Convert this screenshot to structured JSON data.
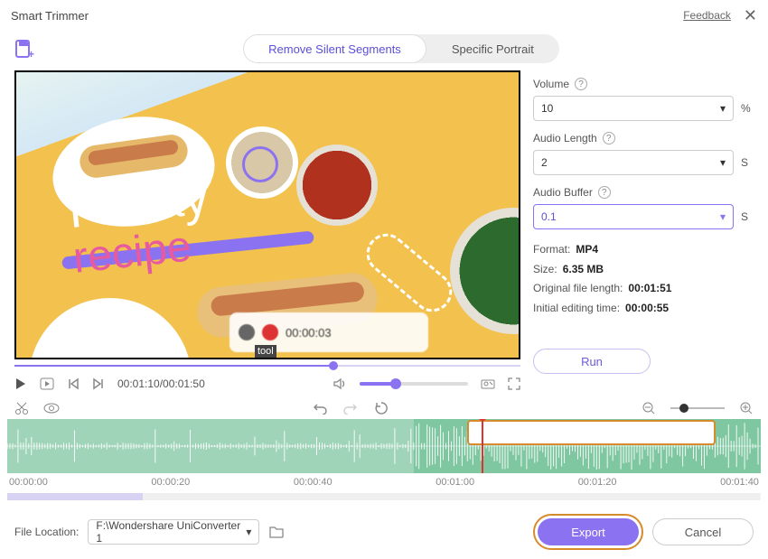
{
  "window": {
    "title": "Smart Trimmer",
    "feedback": "Feedback"
  },
  "tabs": {
    "remove": "Remove Silent Segments",
    "portrait": "Specific Portrait"
  },
  "preview": {
    "script_top": "Friday",
    "script_bottom": "recipe",
    "blur_time": "00:00:03",
    "tool_tip": "tool",
    "time_display": "00:01:10/00:01:50",
    "scrub_percent": 63
  },
  "panel": {
    "volume_label": "Volume",
    "volume_value": "10",
    "volume_unit": "%",
    "length_label": "Audio Length",
    "length_value": "2",
    "length_unit": "S",
    "buffer_label": "Audio Buffer",
    "buffer_value": "0.1",
    "buffer_unit": "S",
    "format_label": "Format:",
    "format_value": "MP4",
    "size_label": "Size:",
    "size_value": "6.35 MB",
    "orig_label": "Original file length:",
    "orig_value": "00:01:51",
    "init_label": "Initial editing time:",
    "init_value": "00:00:55",
    "run": "Run"
  },
  "timeline": {
    "ticks": [
      "00:00:00",
      "00:00:20",
      "00:00:40",
      "00:01:00",
      "00:01:20",
      "00:01:40"
    ],
    "playhead_percent": 63,
    "sel_start_percent": 61,
    "sel_end_percent": 94,
    "kept_segments": [
      [
        0,
        18
      ]
    ]
  },
  "footer": {
    "file_label": "File Location:",
    "file_value": "F:\\Wondershare UniConverter 1",
    "export": "Export",
    "cancel": "Cancel"
  }
}
